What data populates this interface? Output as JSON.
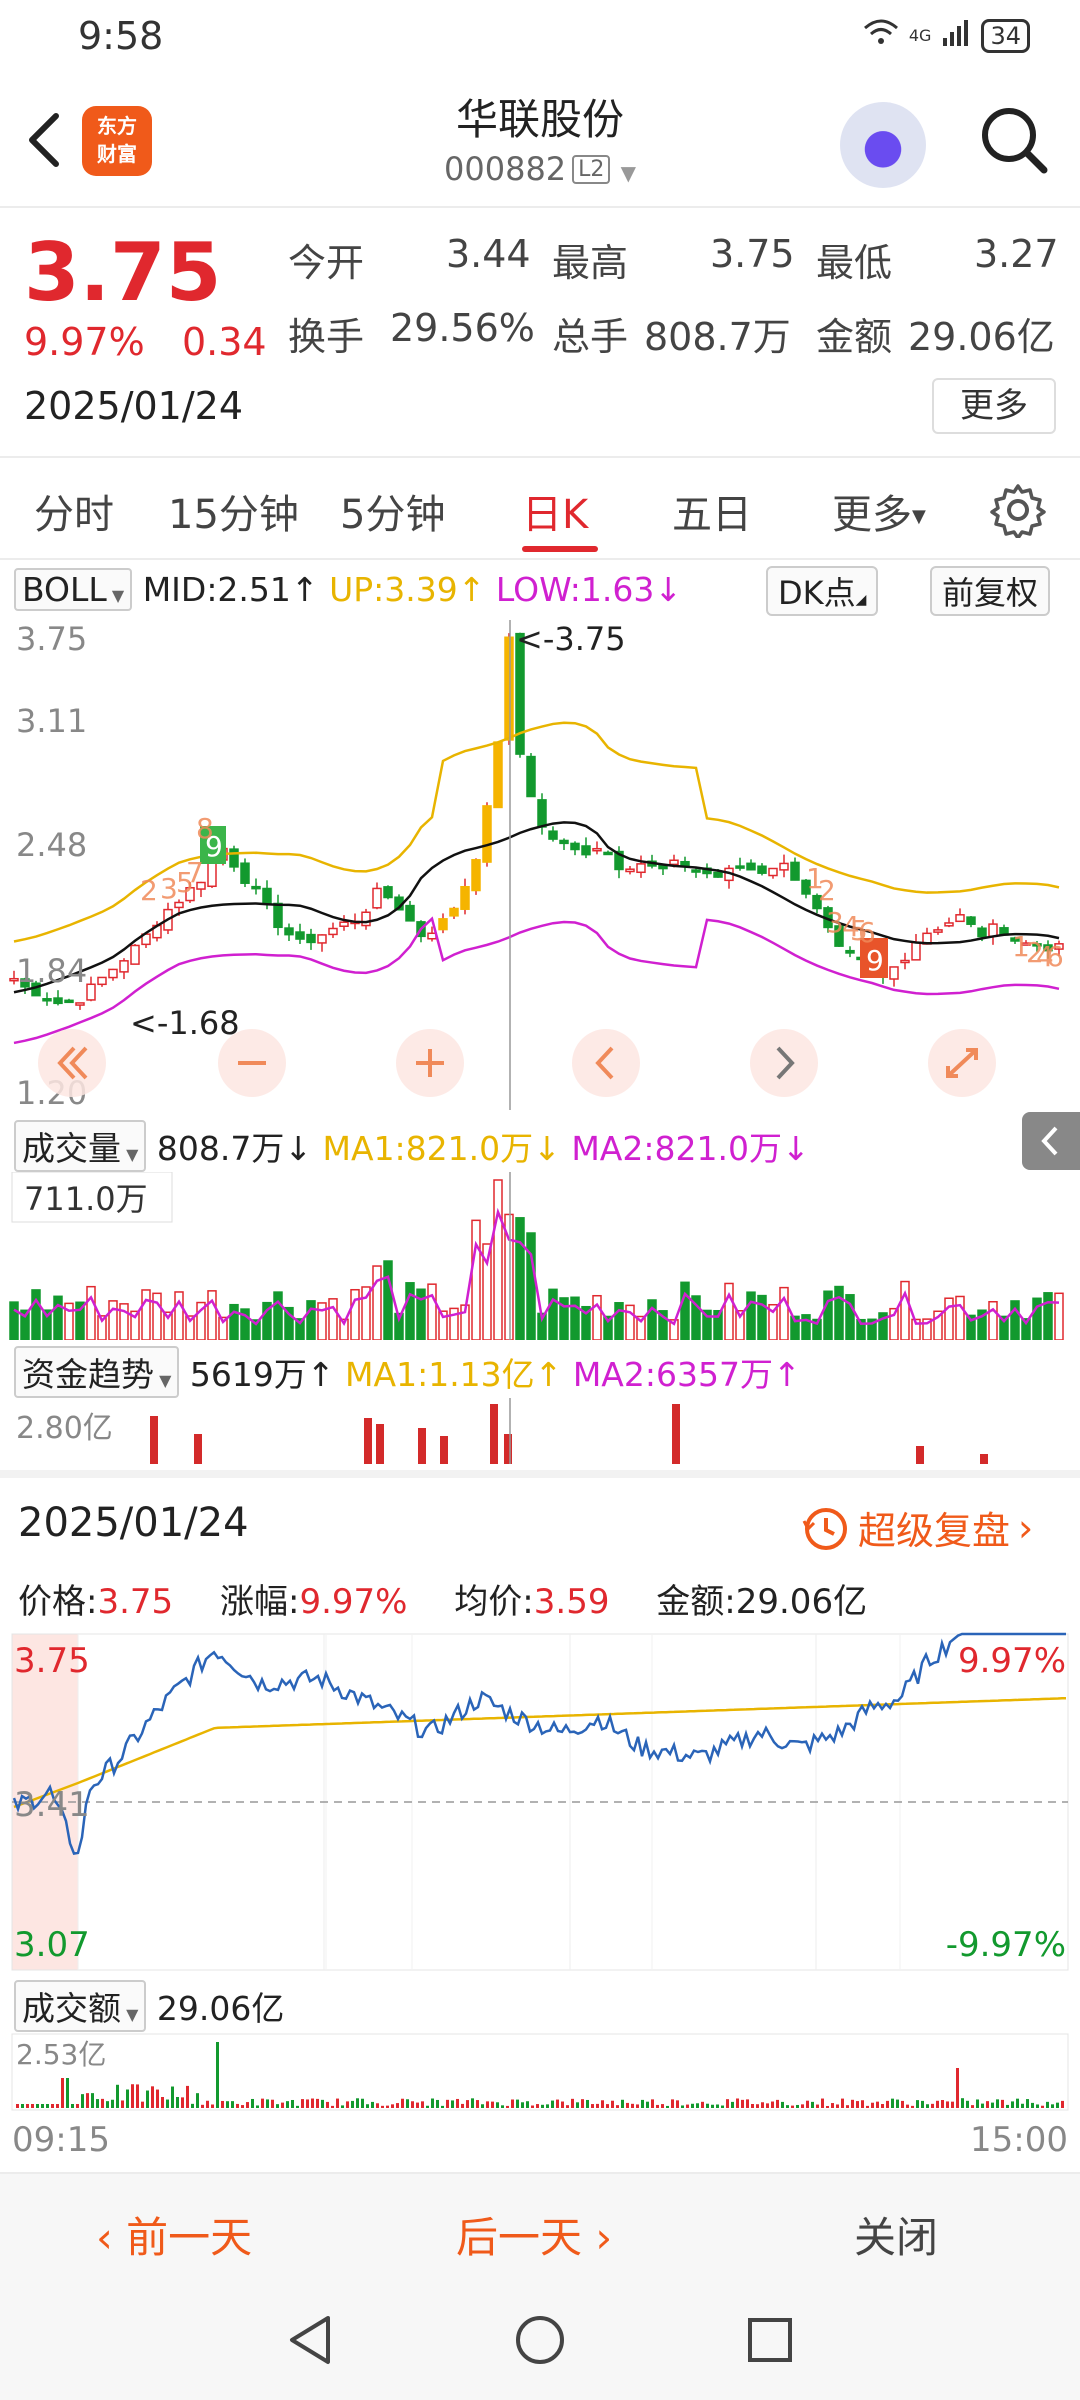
{
  "status": {
    "time": "9:58",
    "network": "4G",
    "battery": "34"
  },
  "header": {
    "app_logo": "东方\n财富",
    "stock_name": "华联股份",
    "stock_code": "000882",
    "level_badge": "L2"
  },
  "quote": {
    "price": "3.75",
    "change_pct": "9.97%",
    "change": "0.34",
    "date": "2025/01/24",
    "open_label": "今开",
    "open": "3.44",
    "high_label": "最高",
    "high": "3.75",
    "low_label": "最低",
    "low": "3.27",
    "turnover_label": "换手",
    "turnover": "29.56%",
    "volume_label": "总手",
    "volume": "808.7万",
    "amount_label": "金额",
    "amount": "29.06亿",
    "more_label": "更多"
  },
  "tabs": {
    "t1": "分时",
    "t2": "15分钟",
    "t3": "5分钟",
    "t4": "日K",
    "t5": "五日",
    "t6": "更多",
    "settings_icon": "gear-icon"
  },
  "kline": {
    "indicator": "BOLL",
    "mid": "MID:2.51↑",
    "up": "UP:3.39↑",
    "low": "LOW:1.63↓",
    "dk_button": "DK点",
    "adjust_button": "前复权",
    "y_labels": [
      "3.75",
      "3.11",
      "2.48",
      "1.84",
      "1.20"
    ],
    "high_marker": "<-3.75",
    "low_marker": "<-1.68",
    "nav_icons": [
      "double-left-icon",
      "minus-icon",
      "plus-icon",
      "left-icon",
      "right-icon",
      "expand-icon"
    ]
  },
  "volume": {
    "label": "成交量",
    "value": "808.7万↓",
    "ma1": "MA1:821.0万↓",
    "ma2": "MA2:821.0万↓",
    "axis_label": "711.0万"
  },
  "fund": {
    "label": "资金趋势",
    "value": "5619万↑",
    "ma1": "MA1:1.13亿↑",
    "ma2": "MA2:6357万↑",
    "axis_label": "2.80亿"
  },
  "intraday": {
    "date": "2025/01/24",
    "replay_label": "超级复盘",
    "price_label": "价格:",
    "price": "3.75",
    "pct_label": "涨幅:",
    "pct": "9.97%",
    "avg_label": "均价:",
    "avg": "3.59",
    "amount_label": "金额:",
    "amount": "29.06亿",
    "y_top": "3.75",
    "y_mid": "3.41",
    "y_bottom": "3.07",
    "pct_top": "9.97%",
    "pct_bottom": "-9.97%",
    "amt_label": "成交额",
    "amt_value": "29.06亿",
    "amt_axis": "2.53亿",
    "time_start": "09:15",
    "time_end": "15:00"
  },
  "bottom": {
    "prev": "前一天",
    "next": "后一天",
    "close": "关闭"
  },
  "colors": {
    "up": "#e0282e",
    "down": "#12992e",
    "accent": "#f05a1a",
    "boll_up": "#e8b400",
    "boll_low": "#d020d0"
  }
}
